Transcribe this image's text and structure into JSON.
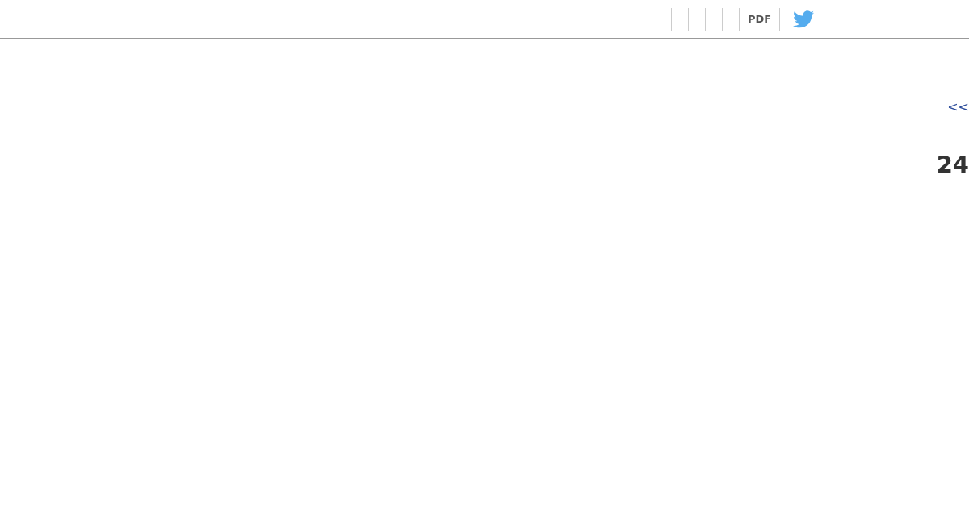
{
  "toolbar": {
    "items": [
      {
        "kind": "text",
        "label": "PDF"
      },
      {
        "kind": "icon"
      }
    ]
  },
  "nav": {
    "prev_link": "<<"
  },
  "heading": "24"
}
